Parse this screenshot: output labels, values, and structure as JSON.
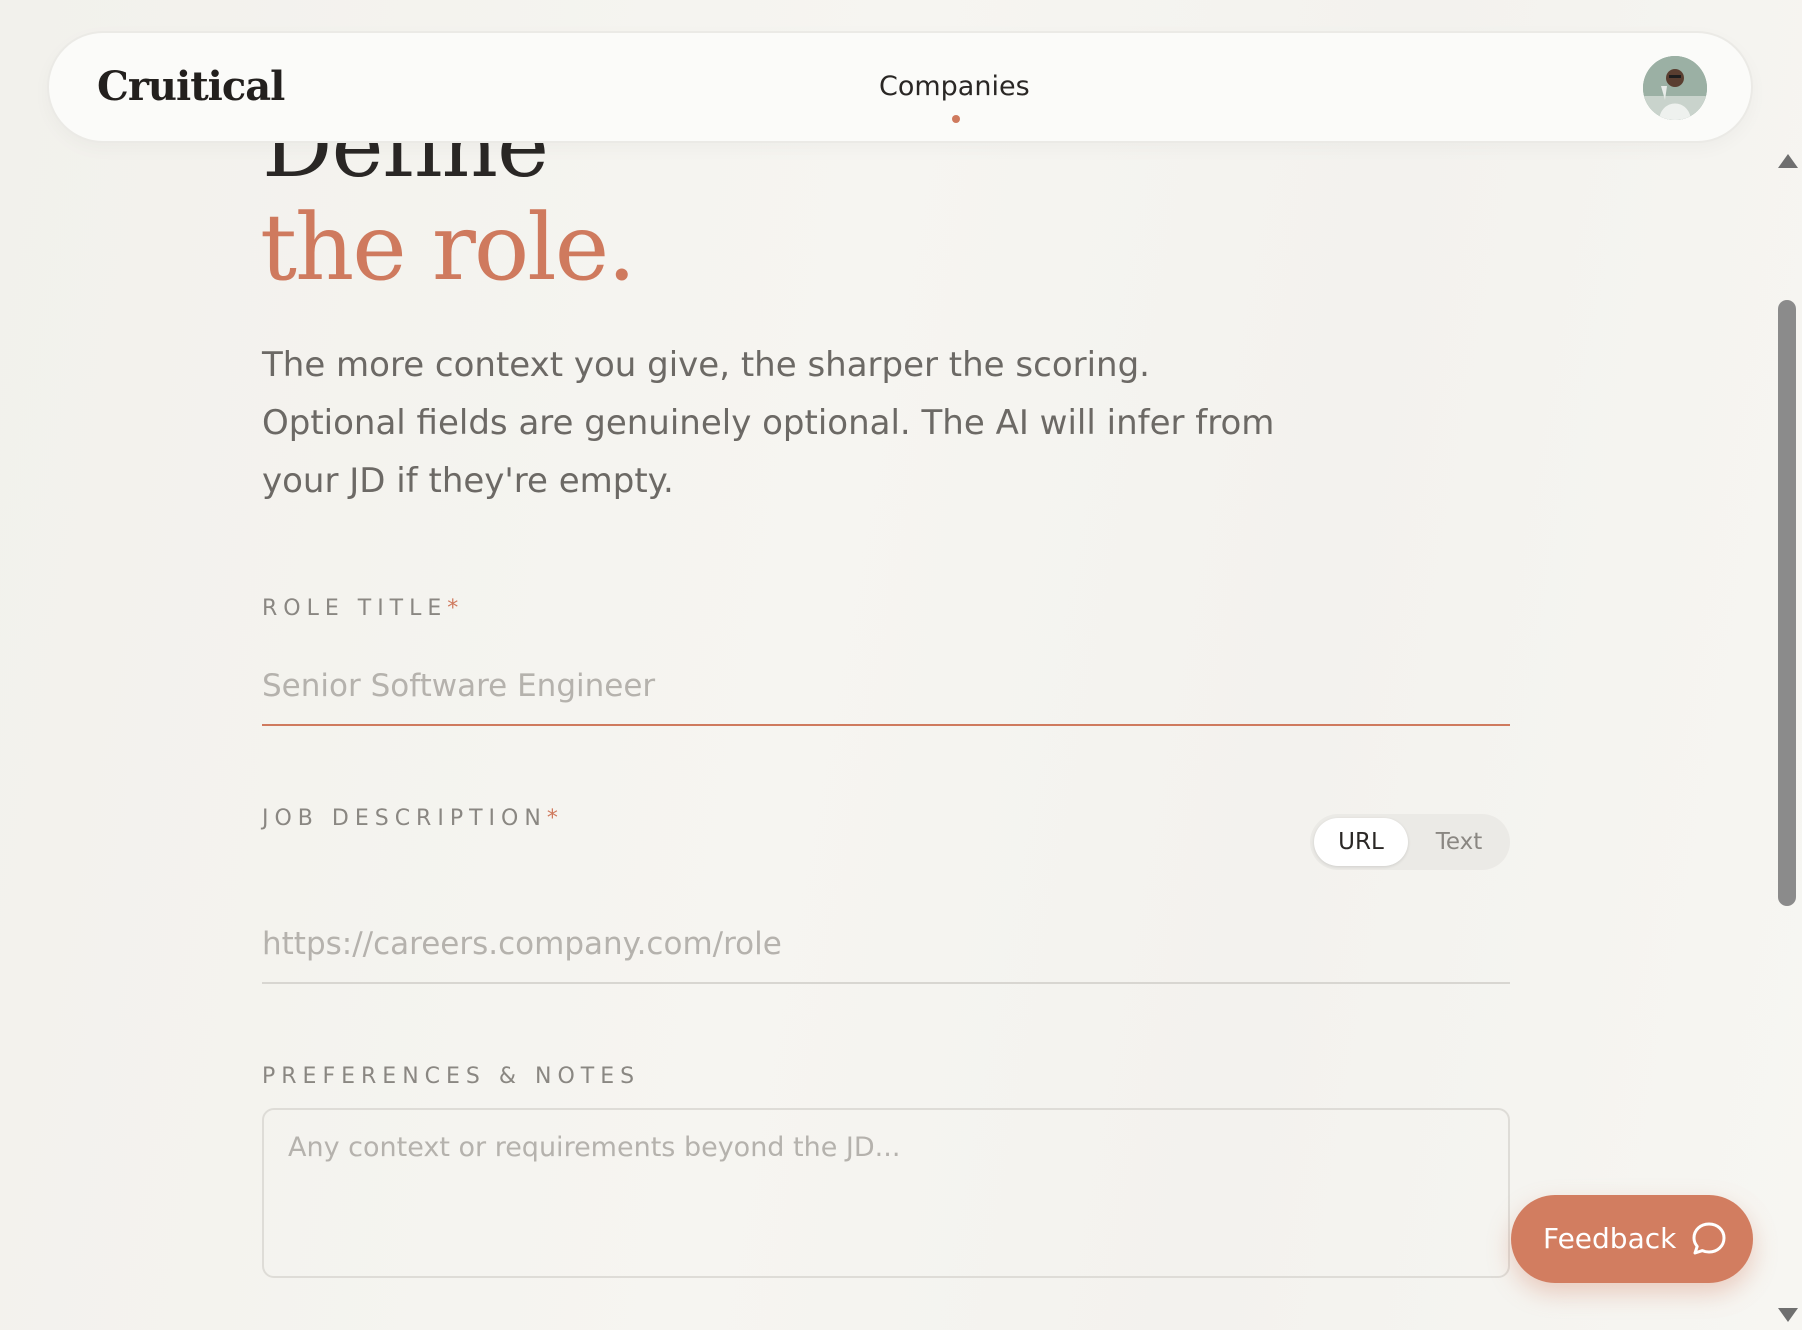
{
  "header": {
    "logo": "Cruitical",
    "nav_items": [
      {
        "label": "Companies",
        "active": true
      }
    ]
  },
  "page": {
    "heading_line1": "Define",
    "heading_line2": "the role.",
    "subtitle": "The more context you give, the sharper the scoring. Optional fields are genuinely optional. The AI will infer from your JD if they're empty."
  },
  "form": {
    "role_title": {
      "label": "ROLE TITLE",
      "required_mark": "*",
      "value": "",
      "placeholder": "Senior Software Engineer"
    },
    "job_description": {
      "label": "JOB DESCRIPTION",
      "required_mark": "*",
      "toggle": {
        "options": [
          "URL",
          "Text"
        ],
        "selected": "URL"
      },
      "value": "",
      "placeholder": "https://careers.company.com/role"
    },
    "preferences": {
      "label": "PREFERENCES & NOTES",
      "value": "",
      "placeholder": "Any context or requirements beyond the JD..."
    }
  },
  "feedback_button": {
    "label": "Feedback",
    "icon": "chat-bubble-icon"
  },
  "colors": {
    "accent": "#cf7a5e",
    "feedback_bg": "#d27d60",
    "text_dark": "#2a2725",
    "text_muted": "#6c6965",
    "label_gray": "#8a8782"
  }
}
